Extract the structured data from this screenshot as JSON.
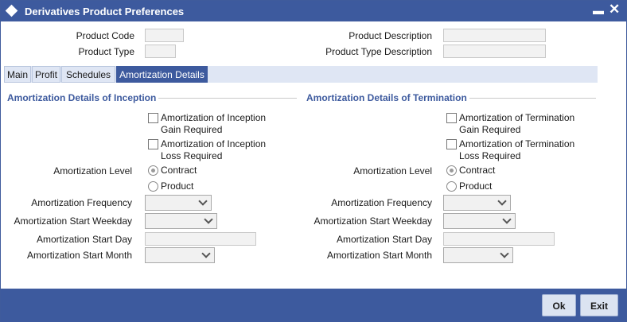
{
  "window": {
    "title": "Derivatives Product Preferences",
    "minimize_glyph": "▬",
    "close_glyph": "✕"
  },
  "header": {
    "product_code_label": "Product Code",
    "product_code_value": "",
    "product_type_label": "Product Type",
    "product_type_value": "",
    "product_description_label": "Product Description",
    "product_description_value": "",
    "product_type_description_label": "Product Type Description",
    "product_type_description_value": ""
  },
  "tabs": [
    {
      "label": "Main",
      "active": false
    },
    {
      "label": "Profit",
      "active": false
    },
    {
      "label": "Schedules",
      "active": false
    },
    {
      "label": "Amortization Details",
      "active": true
    }
  ],
  "inception": {
    "section_title": "Amortization Details of Inception",
    "gain_line1": "Amortization of Inception",
    "gain_line2": "Gain Required",
    "loss_line1": "Amortization of Inception",
    "loss_line2": "Loss Required",
    "level_label": "Amortization Level",
    "level_option_contract": "Contract",
    "level_option_product": "Product",
    "frequency_label": "Amortization Frequency",
    "frequency_value": "",
    "start_weekday_label": "Amortization Start Weekday",
    "start_weekday_value": "",
    "start_day_label": "Amortization Start Day",
    "start_day_value": "",
    "start_month_label": "Amortization Start Month",
    "start_month_value": ""
  },
  "termination": {
    "section_title": "Amortization Details of Termination",
    "gain_line1": "Amortization of Termination",
    "gain_line2": "Gain Required",
    "loss_line1": "Amortization of Termination",
    "loss_line2": "Loss Required",
    "level_label": "Amortization Level",
    "level_option_contract": "Contract",
    "level_option_product": "Product",
    "frequency_label": "Amortization Frequency",
    "frequency_value": "",
    "start_weekday_label": "Amortization Start Weekday",
    "start_weekday_value": "",
    "start_day_label": "Amortization Start Day",
    "start_day_value": "",
    "start_month_label": "Amortization Start Month",
    "start_month_value": ""
  },
  "footer": {
    "ok_label": "Ok",
    "exit_label": "Exit"
  },
  "colors": {
    "title_bar": "#3d5a9e",
    "section_heading": "#3d5a9e",
    "tab_active": "#3d5a9e",
    "tab_inactive": "#dfe6f4"
  }
}
